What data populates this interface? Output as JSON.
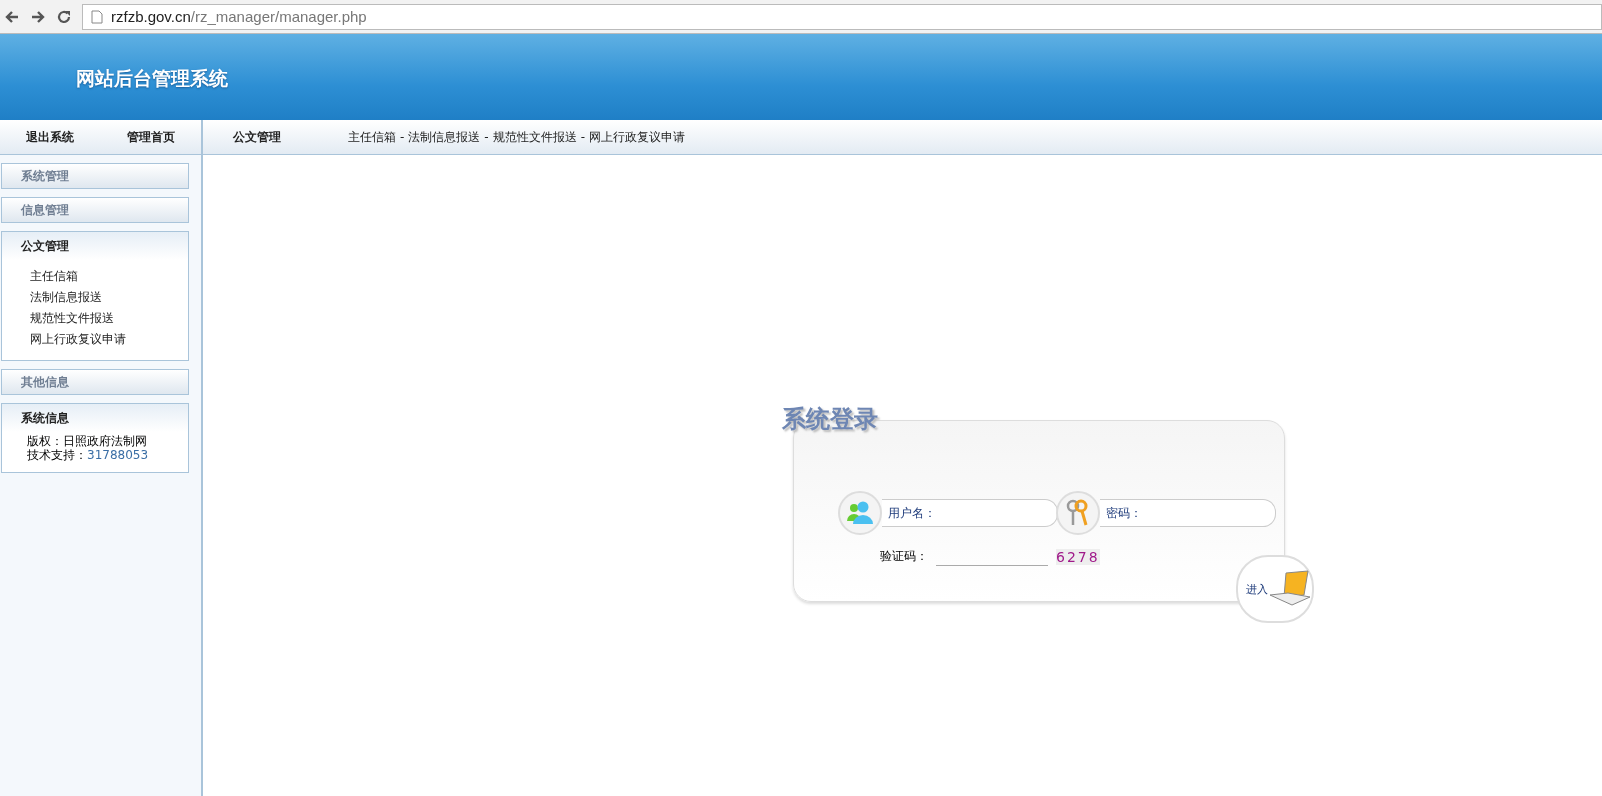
{
  "browser": {
    "url_host": "rzfzb.gov.cn",
    "url_path": "/rz_manager/manager.php"
  },
  "header": {
    "title": "网站后台管理系统"
  },
  "top_nav": {
    "links": [
      "退出系统",
      "管理首页"
    ],
    "section": "公文管理",
    "separator": "-",
    "breadcrumbs": [
      "主任信箱",
      "法制信息报送",
      "规范性文件报送",
      "网上行政复议申请"
    ]
  },
  "sidebar": {
    "panels": [
      {
        "title": "系统管理",
        "expanded": false
      },
      {
        "title": "信息管理",
        "expanded": false
      },
      {
        "kind": "menu",
        "title": "公文管理",
        "expanded": true,
        "items": [
          "主任信箱",
          "法制信息报送",
          "规范性文件报送",
          "网上行政复议申请"
        ]
      },
      {
        "title": "其他信息",
        "expanded": false
      },
      {
        "kind": "info",
        "title": "系统信息",
        "expanded": true,
        "lines": [
          {
            "label": "版权：",
            "value": "日照政府法制网"
          },
          {
            "label": "技术支持：",
            "value": "31788053"
          }
        ]
      }
    ]
  },
  "login": {
    "title": "系统登录",
    "username_label": "用户名：",
    "password_label": "密码：",
    "captcha_label": "验证码：",
    "captcha": "6278",
    "submit": "进入"
  }
}
